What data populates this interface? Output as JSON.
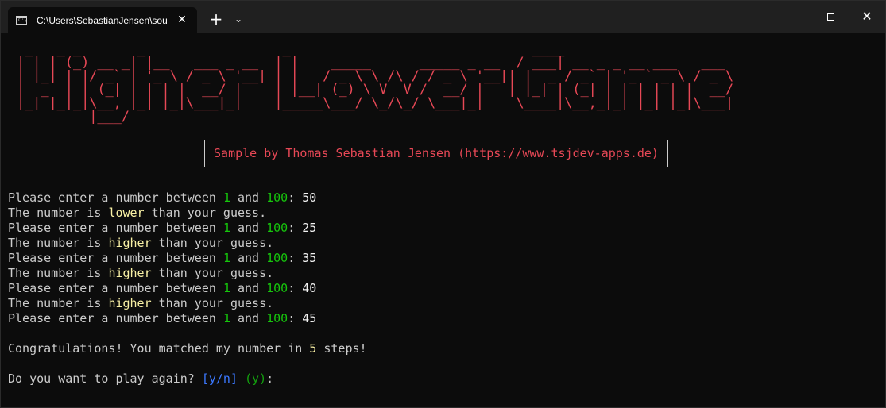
{
  "window": {
    "tab_title": "C:\\Users\\SebastianJensen\\sour",
    "tab_icon_glyph": "C:\\",
    "close_tab_glyph": "✕",
    "new_tab_glyph": "+",
    "dropdown_glyph": "⌄",
    "close_window_glyph": "✕"
  },
  "banner": {
    "ascii_art": " _   _ _       _                 _                              ____                      \n| | | (_) __ _| |__   ___ _ __  | |    _____      _____ _ __  / ___| __ _ _ __ ___   ___ \n| |_| | |/ _` | '_ \\ / _ \\ '__| | |   / _ \\ \\ /\\ / / _ \\ '__|| |  _ / _` | '_ ` _ \\ / _ \\\n|  _  | | (_| | | | |  __/ |    | |__| (_) \\ V  V /  __/ |   | |_| | (_| | | | | | |  __/\n|_| |_|_|\\__, |_| |_|\\___|_|    |_____\\___/ \\_/\\_/ \\___|_|    \\____|\\__,_|_| |_| |_|\\___|\n         |___/                                                                          ",
    "color": "#e74856"
  },
  "subtitle": "Sample by Thomas Sebastian Jensen (https://www.tsjdev-apps.de)",
  "prompt": {
    "prefix": "Please enter a number between ",
    "min": "1",
    "and": " and ",
    "max": "100",
    "suffix": ": "
  },
  "feedback": {
    "prefix": "The number is ",
    "suffix": " than your guess."
  },
  "rounds": [
    {
      "guess": "50",
      "hint": "lower"
    },
    {
      "guess": "25",
      "hint": "higher"
    },
    {
      "guess": "35",
      "hint": "higher"
    },
    {
      "guess": "40",
      "hint": "higher"
    },
    {
      "guess": "45"
    }
  ],
  "congrats": {
    "prefix": "Congratulations! You matched my number in ",
    "steps": "5",
    "suffix": " steps!"
  },
  "replay": {
    "question": "Do you want to play again? ",
    "options": "[y/n]",
    "default": "(y)",
    "colon": ":"
  },
  "colors": {
    "background": "#0c0c0c",
    "text": "#cccccc",
    "banner_red": "#e74856",
    "range_green": "#16c60c",
    "hint_yellow": "#f9f1a5",
    "options_blue": "#3b78ff",
    "default_green": "#13a10e"
  }
}
